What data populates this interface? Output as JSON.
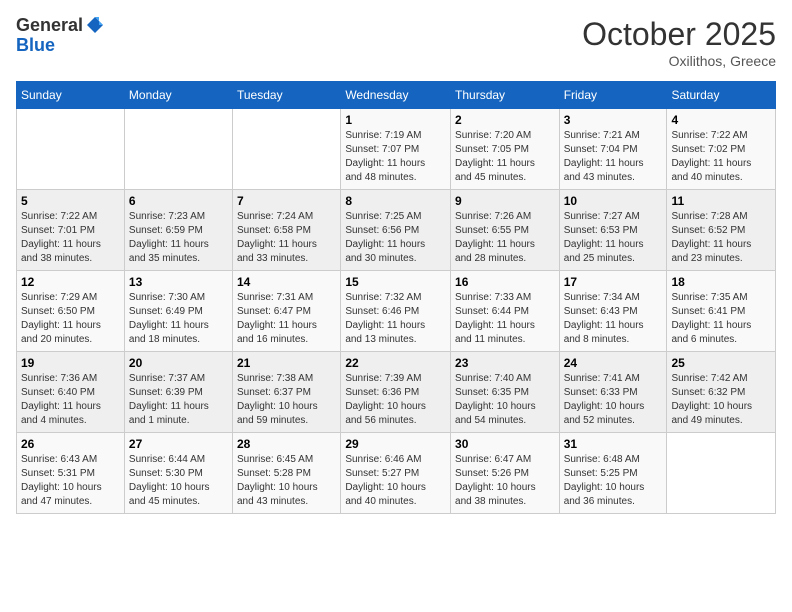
{
  "logo": {
    "general": "General",
    "blue": "Blue"
  },
  "title": "October 2025",
  "location": "Oxilithos, Greece",
  "days_header": [
    "Sunday",
    "Monday",
    "Tuesday",
    "Wednesday",
    "Thursday",
    "Friday",
    "Saturday"
  ],
  "weeks": [
    [
      {
        "num": "",
        "info": ""
      },
      {
        "num": "",
        "info": ""
      },
      {
        "num": "",
        "info": ""
      },
      {
        "num": "1",
        "info": "Sunrise: 7:19 AM\nSunset: 7:07 PM\nDaylight: 11 hours\nand 48 minutes."
      },
      {
        "num": "2",
        "info": "Sunrise: 7:20 AM\nSunset: 7:05 PM\nDaylight: 11 hours\nand 45 minutes."
      },
      {
        "num": "3",
        "info": "Sunrise: 7:21 AM\nSunset: 7:04 PM\nDaylight: 11 hours\nand 43 minutes."
      },
      {
        "num": "4",
        "info": "Sunrise: 7:22 AM\nSunset: 7:02 PM\nDaylight: 11 hours\nand 40 minutes."
      }
    ],
    [
      {
        "num": "5",
        "info": "Sunrise: 7:22 AM\nSunset: 7:01 PM\nDaylight: 11 hours\nand 38 minutes."
      },
      {
        "num": "6",
        "info": "Sunrise: 7:23 AM\nSunset: 6:59 PM\nDaylight: 11 hours\nand 35 minutes."
      },
      {
        "num": "7",
        "info": "Sunrise: 7:24 AM\nSunset: 6:58 PM\nDaylight: 11 hours\nand 33 minutes."
      },
      {
        "num": "8",
        "info": "Sunrise: 7:25 AM\nSunset: 6:56 PM\nDaylight: 11 hours\nand 30 minutes."
      },
      {
        "num": "9",
        "info": "Sunrise: 7:26 AM\nSunset: 6:55 PM\nDaylight: 11 hours\nand 28 minutes."
      },
      {
        "num": "10",
        "info": "Sunrise: 7:27 AM\nSunset: 6:53 PM\nDaylight: 11 hours\nand 25 minutes."
      },
      {
        "num": "11",
        "info": "Sunrise: 7:28 AM\nSunset: 6:52 PM\nDaylight: 11 hours\nand 23 minutes."
      }
    ],
    [
      {
        "num": "12",
        "info": "Sunrise: 7:29 AM\nSunset: 6:50 PM\nDaylight: 11 hours\nand 20 minutes."
      },
      {
        "num": "13",
        "info": "Sunrise: 7:30 AM\nSunset: 6:49 PM\nDaylight: 11 hours\nand 18 minutes."
      },
      {
        "num": "14",
        "info": "Sunrise: 7:31 AM\nSunset: 6:47 PM\nDaylight: 11 hours\nand 16 minutes."
      },
      {
        "num": "15",
        "info": "Sunrise: 7:32 AM\nSunset: 6:46 PM\nDaylight: 11 hours\nand 13 minutes."
      },
      {
        "num": "16",
        "info": "Sunrise: 7:33 AM\nSunset: 6:44 PM\nDaylight: 11 hours\nand 11 minutes."
      },
      {
        "num": "17",
        "info": "Sunrise: 7:34 AM\nSunset: 6:43 PM\nDaylight: 11 hours\nand 8 minutes."
      },
      {
        "num": "18",
        "info": "Sunrise: 7:35 AM\nSunset: 6:41 PM\nDaylight: 11 hours\nand 6 minutes."
      }
    ],
    [
      {
        "num": "19",
        "info": "Sunrise: 7:36 AM\nSunset: 6:40 PM\nDaylight: 11 hours\nand 4 minutes."
      },
      {
        "num": "20",
        "info": "Sunrise: 7:37 AM\nSunset: 6:39 PM\nDaylight: 11 hours\nand 1 minute."
      },
      {
        "num": "21",
        "info": "Sunrise: 7:38 AM\nSunset: 6:37 PM\nDaylight: 10 hours\nand 59 minutes."
      },
      {
        "num": "22",
        "info": "Sunrise: 7:39 AM\nSunset: 6:36 PM\nDaylight: 10 hours\nand 56 minutes."
      },
      {
        "num": "23",
        "info": "Sunrise: 7:40 AM\nSunset: 6:35 PM\nDaylight: 10 hours\nand 54 minutes."
      },
      {
        "num": "24",
        "info": "Sunrise: 7:41 AM\nSunset: 6:33 PM\nDaylight: 10 hours\nand 52 minutes."
      },
      {
        "num": "25",
        "info": "Sunrise: 7:42 AM\nSunset: 6:32 PM\nDaylight: 10 hours\nand 49 minutes."
      }
    ],
    [
      {
        "num": "26",
        "info": "Sunrise: 6:43 AM\nSunset: 5:31 PM\nDaylight: 10 hours\nand 47 minutes."
      },
      {
        "num": "27",
        "info": "Sunrise: 6:44 AM\nSunset: 5:30 PM\nDaylight: 10 hours\nand 45 minutes."
      },
      {
        "num": "28",
        "info": "Sunrise: 6:45 AM\nSunset: 5:28 PM\nDaylight: 10 hours\nand 43 minutes."
      },
      {
        "num": "29",
        "info": "Sunrise: 6:46 AM\nSunset: 5:27 PM\nDaylight: 10 hours\nand 40 minutes."
      },
      {
        "num": "30",
        "info": "Sunrise: 6:47 AM\nSunset: 5:26 PM\nDaylight: 10 hours\nand 38 minutes."
      },
      {
        "num": "31",
        "info": "Sunrise: 6:48 AM\nSunset: 5:25 PM\nDaylight: 10 hours\nand 36 minutes."
      },
      {
        "num": "",
        "info": ""
      }
    ]
  ]
}
